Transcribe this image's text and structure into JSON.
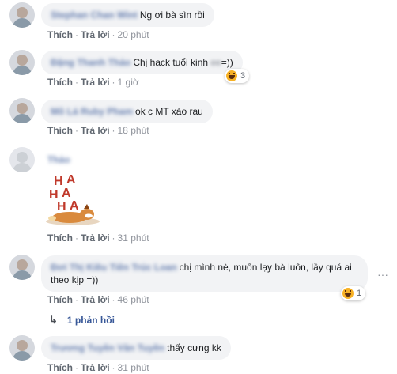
{
  "actions": {
    "like": "Thích",
    "reply": "Trả lời",
    "sep": "·"
  },
  "comments": [
    {
      "author": "Stephan Chan Wint",
      "text": "Ng ơi bà sìn rồi",
      "time": "20 phút"
    },
    {
      "author": "Đặng Thanh Thảo",
      "text": "Chị hack tuổi kinh",
      "text_blur": "=))",
      "text_end": "=))",
      "time": "1 giờ",
      "reactions": {
        "icon": "haha-icon",
        "count": "3"
      }
    },
    {
      "author": "Mô Lá Ruby Pham",
      "text": "ok c MT xào rau",
      "time": "18 phút"
    },
    {
      "author": "Thảo",
      "text": "",
      "sticker": "haha-sticker",
      "sticker_text": "HA HA HA",
      "time": "31 phút"
    },
    {
      "author": "Đơi Thị Kiều Tiên Trúc Loan",
      "text": "chị mình nè, muốn lạy bà luôn, lầy quá ai theo kịp =))",
      "time": "46 phút",
      "reactions": {
        "icon": "haha-icon",
        "count": "1"
      },
      "replies": "1 phản hồi"
    },
    {
      "author": "Trương Tuyền Văn Tuyền",
      "text": "thấy cưng kk",
      "time": "31 phút"
    }
  ],
  "colors": {
    "link": "#385898",
    "bubble": "#f2f3f5",
    "meta": "#606770",
    "haha": "#f7b125"
  }
}
